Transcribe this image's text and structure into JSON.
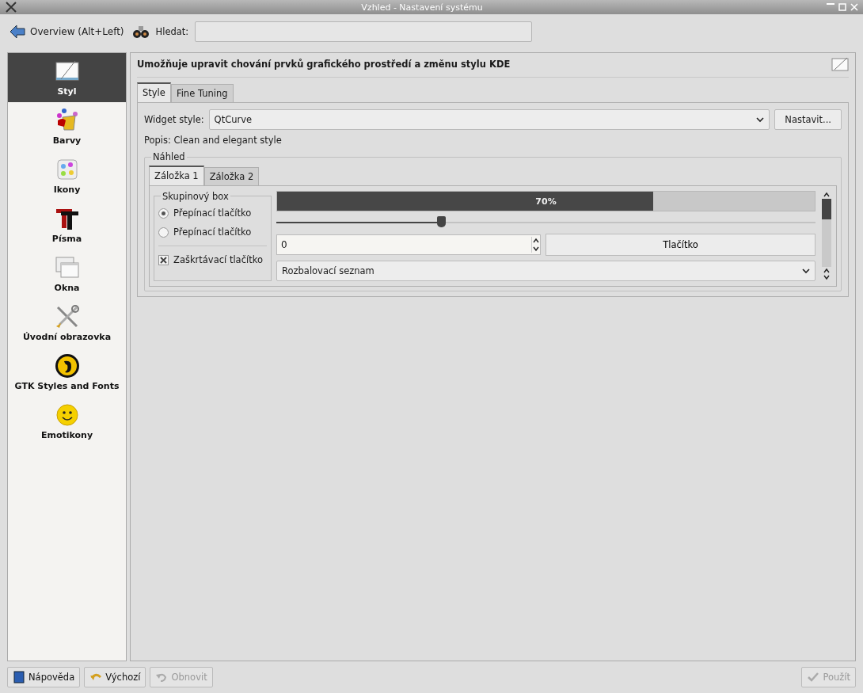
{
  "window": {
    "title": "Vzhled - Nastavení systému"
  },
  "toolbar": {
    "back_button": "Overview (Alt+Left)",
    "search_label": "Hledat:"
  },
  "sidebar": {
    "items": [
      {
        "label": "Styl",
        "kind": "style",
        "selected": true
      },
      {
        "label": "Barvy",
        "kind": "colors",
        "selected": false
      },
      {
        "label": "Ikony",
        "kind": "icons",
        "selected": false
      },
      {
        "label": "Písma",
        "kind": "fonts",
        "selected": false
      },
      {
        "label": "Okna",
        "kind": "windows",
        "selected": false
      },
      {
        "label": "Úvodní obrazovka",
        "kind": "splash",
        "selected": false
      },
      {
        "label": "GTK Styles and Fonts",
        "kind": "gtk",
        "selected": false
      },
      {
        "label": "Emotikony",
        "kind": "emoticons",
        "selected": false
      }
    ]
  },
  "header": "Umožňuje upravit chování prvků grafického prostředí a změnu stylu KDE",
  "tabs": [
    {
      "label": "Style",
      "selected": true
    },
    {
      "label": "Fine Tuning",
      "selected": false
    }
  ],
  "widget_style": {
    "label": "Widget style:",
    "value": "QtCurve",
    "button": "Nastavit..."
  },
  "description": "Popis: Clean and elegant style",
  "preview": {
    "title": "Náhled",
    "tabs": [
      {
        "label": "Záložka 1",
        "selected": true
      },
      {
        "label": "Záložka 2",
        "selected": false
      }
    ],
    "group": {
      "title": "Skupinový box",
      "radios": [
        {
          "label": "Přepínací tlačítko",
          "selected": true
        },
        {
          "label": "Přepínací tlačítko",
          "selected": false
        }
      ],
      "checkbox": {
        "label": "Zaškrtávací tlačítko",
        "checked": true
      }
    },
    "progress": {
      "level": 0.7,
      "text": "70%"
    },
    "slider": {
      "level": 0.305
    },
    "spinbox": {
      "value": "0"
    },
    "button": "Tlačítko",
    "combo": "Rozbalovací seznam"
  },
  "footer": {
    "buttons": [
      {
        "label": "Nápověda",
        "kind": "help",
        "disabled": false
      },
      {
        "label": "Výchozí",
        "kind": "defaults",
        "disabled": false
      },
      {
        "label": "Obnovit",
        "kind": "reset",
        "disabled": true
      },
      {
        "label": "Použít",
        "kind": "apply",
        "disabled": true
      }
    ]
  }
}
